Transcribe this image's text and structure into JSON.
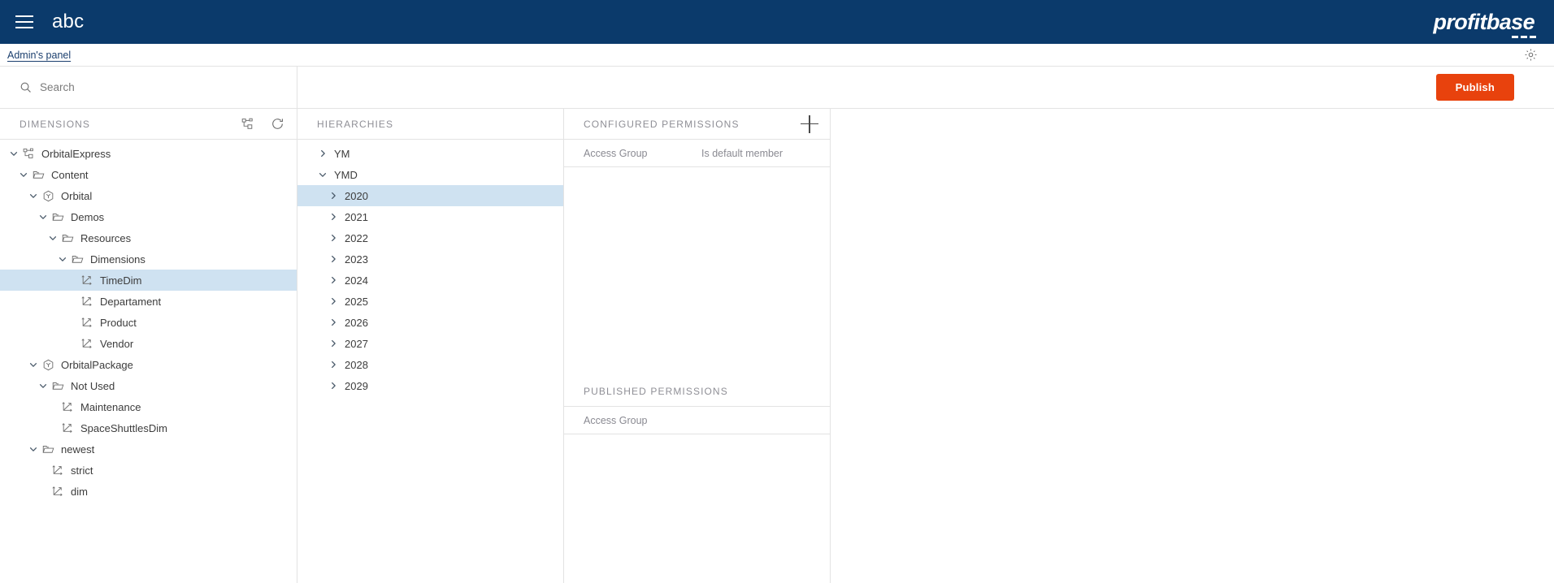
{
  "topbar": {
    "menu_icon": "hamburger-icon",
    "app_title": "abc",
    "brand": "profitbase"
  },
  "breadcrumb": {
    "link": "Admin's panel",
    "settings_icon": "gear-icon"
  },
  "search": {
    "placeholder": "Search",
    "value": "",
    "icon": "search-icon"
  },
  "toolbar": {
    "publish_label": "Publish"
  },
  "dimensions_panel": {
    "title": "DIMENSIONS",
    "actions": [
      {
        "name": "model-graph-icon",
        "label": "Models"
      },
      {
        "name": "refresh-icon",
        "label": "Refresh"
      }
    ],
    "tree": [
      {
        "label": "OrbitalExpress",
        "depth": 0,
        "icon": "model-graph-icon",
        "chevron": "down",
        "selected": false
      },
      {
        "label": "Content",
        "depth": 1,
        "icon": "folder-icon",
        "chevron": "down",
        "selected": false
      },
      {
        "label": "Orbital",
        "depth": 2,
        "icon": "cube-icon",
        "chevron": "down",
        "selected": false
      },
      {
        "label": "Demos",
        "depth": 3,
        "icon": "folder-icon",
        "chevron": "down",
        "selected": false
      },
      {
        "label": "Resources",
        "depth": 4,
        "icon": "folder-icon",
        "chevron": "down",
        "selected": false
      },
      {
        "label": "Dimensions",
        "depth": 5,
        "icon": "folder-icon",
        "chevron": "down",
        "selected": false
      },
      {
        "label": "TimeDim",
        "depth": 6,
        "icon": "dimension-icon",
        "chevron": "none",
        "selected": true
      },
      {
        "label": "Departament",
        "depth": 6,
        "icon": "dimension-icon",
        "chevron": "none",
        "selected": false
      },
      {
        "label": "Product",
        "depth": 6,
        "icon": "dimension-icon",
        "chevron": "none",
        "selected": false
      },
      {
        "label": "Vendor",
        "depth": 6,
        "icon": "dimension-icon",
        "chevron": "none",
        "selected": false
      },
      {
        "label": "OrbitalPackage",
        "depth": 2,
        "icon": "cube-icon",
        "chevron": "down",
        "selected": false
      },
      {
        "label": "Not Used",
        "depth": 3,
        "icon": "folder-icon",
        "chevron": "down",
        "selected": false
      },
      {
        "label": "Maintenance",
        "depth": 4,
        "icon": "dimension-icon",
        "chevron": "none",
        "selected": false
      },
      {
        "label": "SpaceShuttlesDim",
        "depth": 4,
        "icon": "dimension-icon",
        "chevron": "none",
        "selected": false
      },
      {
        "label": "newest",
        "depth": 2,
        "icon": "folder-icon",
        "chevron": "down",
        "selected": false
      },
      {
        "label": "strict",
        "depth": 3,
        "icon": "dimension-icon",
        "chevron": "none",
        "selected": false
      },
      {
        "label": "dim",
        "depth": 3,
        "icon": "dimension-icon",
        "chevron": "none",
        "selected": false
      }
    ]
  },
  "hierarchies_panel": {
    "title": "HIERARCHIES",
    "rows": [
      {
        "label": "YM",
        "depth": 0,
        "chevron": "right",
        "selected": false
      },
      {
        "label": "YMD",
        "depth": 0,
        "chevron": "down",
        "selected": false
      },
      {
        "label": "2020",
        "depth": 1,
        "chevron": "right",
        "selected": true
      },
      {
        "label": "2021",
        "depth": 1,
        "chevron": "right",
        "selected": false
      },
      {
        "label": "2022",
        "depth": 1,
        "chevron": "right",
        "selected": false
      },
      {
        "label": "2023",
        "depth": 1,
        "chevron": "right",
        "selected": false
      },
      {
        "label": "2024",
        "depth": 1,
        "chevron": "right",
        "selected": false
      },
      {
        "label": "2025",
        "depth": 1,
        "chevron": "right",
        "selected": false
      },
      {
        "label": "2026",
        "depth": 1,
        "chevron": "right",
        "selected": false
      },
      {
        "label": "2027",
        "depth": 1,
        "chevron": "right",
        "selected": false
      },
      {
        "label": "2028",
        "depth": 1,
        "chevron": "right",
        "selected": false
      },
      {
        "label": "2029",
        "depth": 1,
        "chevron": "right",
        "selected": false
      }
    ]
  },
  "permissions_panel": {
    "configured": {
      "title": "CONFIGURED PERMISSIONS",
      "add_icon": "plus-icon",
      "columns": [
        "Access Group",
        "Is default member"
      ],
      "rows": []
    },
    "published": {
      "title": "PUBLISHED PERMISSIONS",
      "columns": [
        "Access Group"
      ],
      "rows": []
    }
  },
  "colors": {
    "nav_blue": "#0b3a6b",
    "publish_orange": "#e8420d",
    "selection_blue": "#cfe2f1",
    "border_grey": "#e3e3e3",
    "muted_text": "#8f8f96"
  }
}
